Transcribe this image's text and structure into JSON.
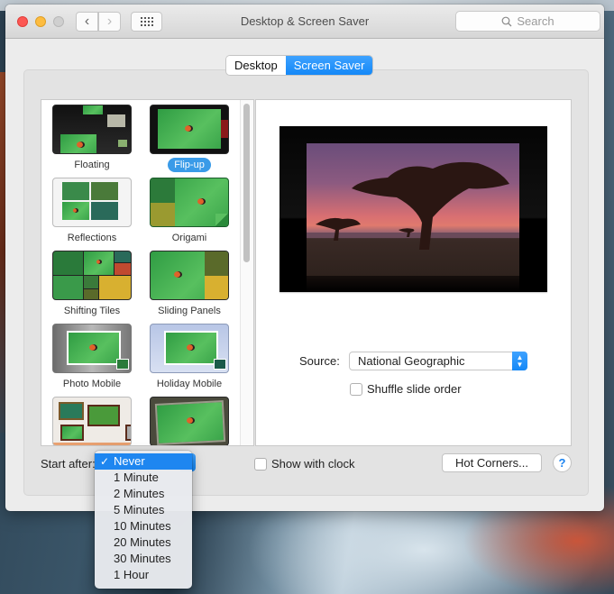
{
  "window": {
    "title": "Desktop & Screen Saver",
    "search_placeholder": "Search"
  },
  "tabs": [
    {
      "label": "Desktop",
      "active": false
    },
    {
      "label": "Screen Saver",
      "active": true
    }
  ],
  "screen_savers": [
    {
      "label": "Floating",
      "selected": false
    },
    {
      "label": "Flip-up",
      "selected": true
    },
    {
      "label": "Reflections",
      "selected": false
    },
    {
      "label": "Origami",
      "selected": false
    },
    {
      "label": "Shifting Tiles",
      "selected": false
    },
    {
      "label": "Sliding Panels",
      "selected": false
    },
    {
      "label": "Photo Mobile",
      "selected": false
    },
    {
      "label": "Holiday Mobile",
      "selected": false
    },
    {
      "label": "",
      "selected": false
    },
    {
      "label": "",
      "selected": false
    }
  ],
  "options": {
    "source_label": "Source:",
    "source_value": "National Geographic",
    "shuffle_label": "Shuffle slide order",
    "shuffle_checked": false
  },
  "footer": {
    "start_after_label": "Start after:",
    "show_clock_label": "Show with clock",
    "show_clock_checked": false,
    "hot_corners_label": "Hot Corners...",
    "help_label": "?"
  },
  "start_after_menu": {
    "check_glyph": "✓",
    "items": [
      {
        "label": "Never",
        "selected": true
      },
      {
        "label": "1 Minute",
        "selected": false
      },
      {
        "label": "2 Minutes",
        "selected": false
      },
      {
        "label": "5 Minutes",
        "selected": false
      },
      {
        "label": "10 Minutes",
        "selected": false
      },
      {
        "label": "20 Minutes",
        "selected": false
      },
      {
        "label": "30 Minutes",
        "selected": false
      },
      {
        "label": "1 Hour",
        "selected": false
      }
    ]
  },
  "colors": {
    "accent": "#1488f7",
    "selection_pill": "#3a9be8",
    "close": "#fc5753",
    "minimize": "#fdbc40"
  }
}
